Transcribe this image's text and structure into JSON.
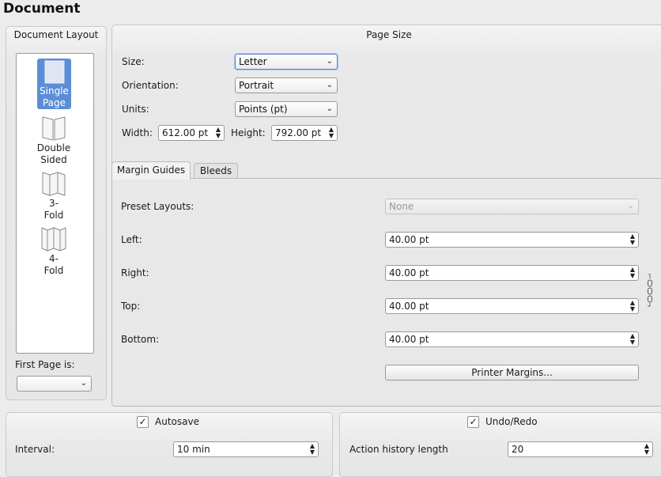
{
  "window_title": "Document",
  "document_layout": {
    "title": "Document Layout",
    "items": [
      {
        "line1": "Single",
        "line2": "Page",
        "selected": true
      },
      {
        "line1": "Double",
        "line2": "Sided",
        "selected": false
      },
      {
        "line1": "3-",
        "line2": "Fold",
        "selected": false
      },
      {
        "line1": "4-",
        "line2": "Fold",
        "selected": false
      }
    ],
    "first_page_label": "First Page is:",
    "first_page_value": ""
  },
  "page_size": {
    "title": "Page Size",
    "size_label": "Size:",
    "size_value": "Letter",
    "orientation_label": "Orientation:",
    "orientation_value": "Portrait",
    "units_label": "Units:",
    "units_value": "Points (pt)",
    "width_label": "Width:",
    "width_value": "612.00 pt",
    "height_label": "Height:",
    "height_value": "792.00 pt"
  },
  "tabs": [
    {
      "label": "Margin Guides",
      "active": true
    },
    {
      "label": "Bleeds",
      "active": false
    }
  ],
  "margins": {
    "preset_label": "Preset Layouts:",
    "preset_value": "None",
    "left_label": "Left:",
    "left_value": "40.00 pt",
    "right_label": "Right:",
    "right_value": "40.00 pt",
    "top_label": "Top:",
    "top_value": "40.00 pt",
    "bottom_label": "Bottom:",
    "bottom_value": "40.00 pt",
    "printer_margins_button": "Printer Margins..."
  },
  "autosave": {
    "label": "Autosave",
    "checked": true,
    "interval_label": "Interval:",
    "interval_value": "10 min"
  },
  "undo": {
    "label": "Undo/Redo",
    "checked": true,
    "history_label": "Action history length",
    "history_value": "20"
  },
  "icons": {
    "check": "✓",
    "combo_arrow": "chevron-down",
    "spin_arrows": "up-down",
    "chain": "chain-link"
  }
}
